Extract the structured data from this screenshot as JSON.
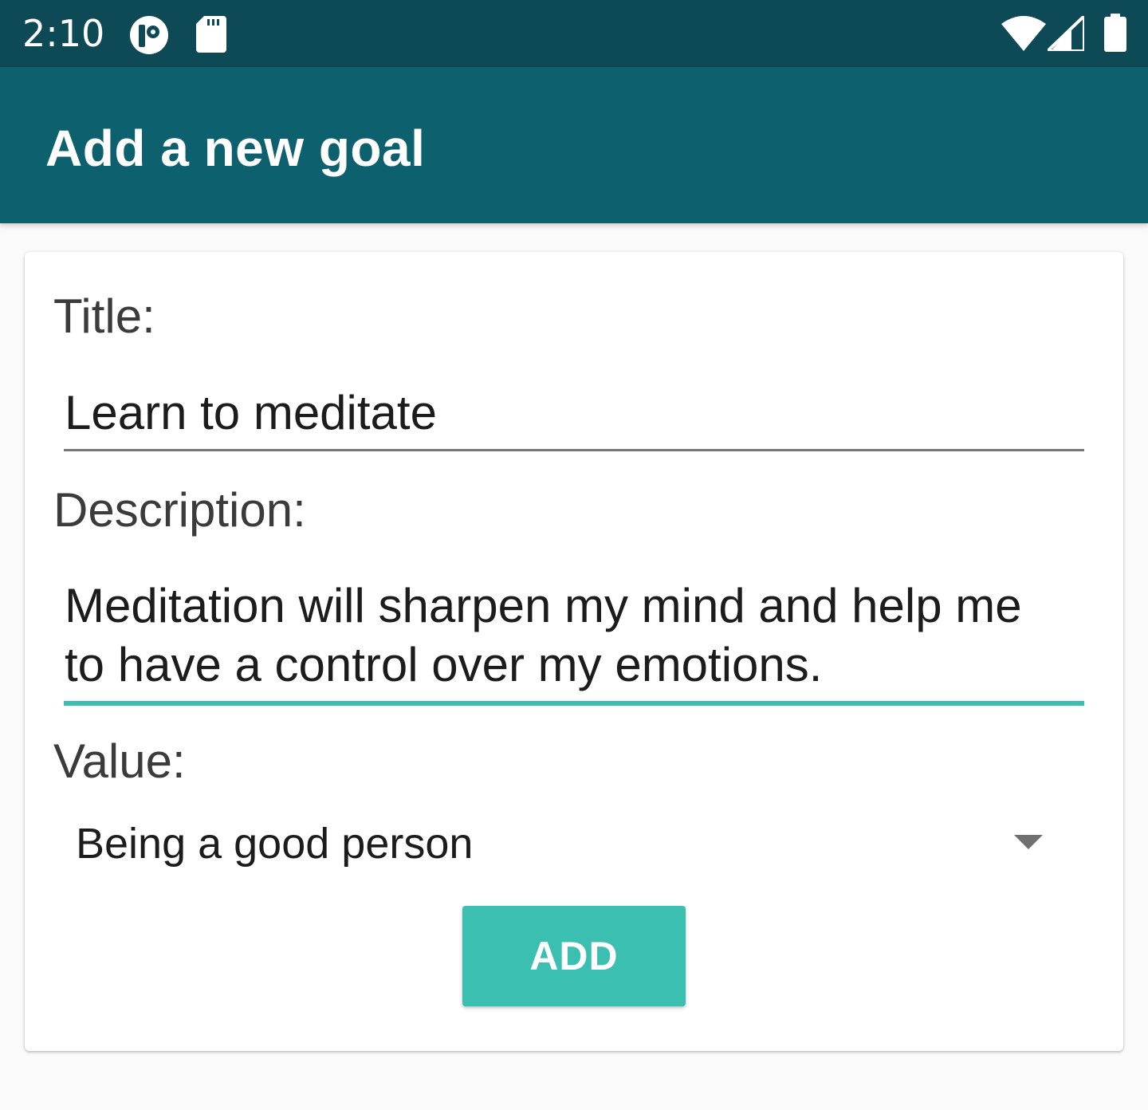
{
  "status_bar": {
    "time": "2:10",
    "icons": [
      "app-notification-icon",
      "sd-card-icon",
      "wifi-icon",
      "cell-signal-icon",
      "battery-icon"
    ],
    "background_color": "#0d4a55"
  },
  "app_bar": {
    "title": "Add a new goal",
    "background_color": "#0d616f"
  },
  "form": {
    "title_label": "Title:",
    "title_value": "Learn to meditate",
    "description_label": "Description:",
    "description_line1": "Meditation will sharpen my mind and help me",
    "description_line2": "to have a control over my emotions.",
    "value_label": "Value:",
    "value_selected": "Being a good person",
    "add_button_label": "ADD",
    "accent_color": "#3abfb1"
  }
}
